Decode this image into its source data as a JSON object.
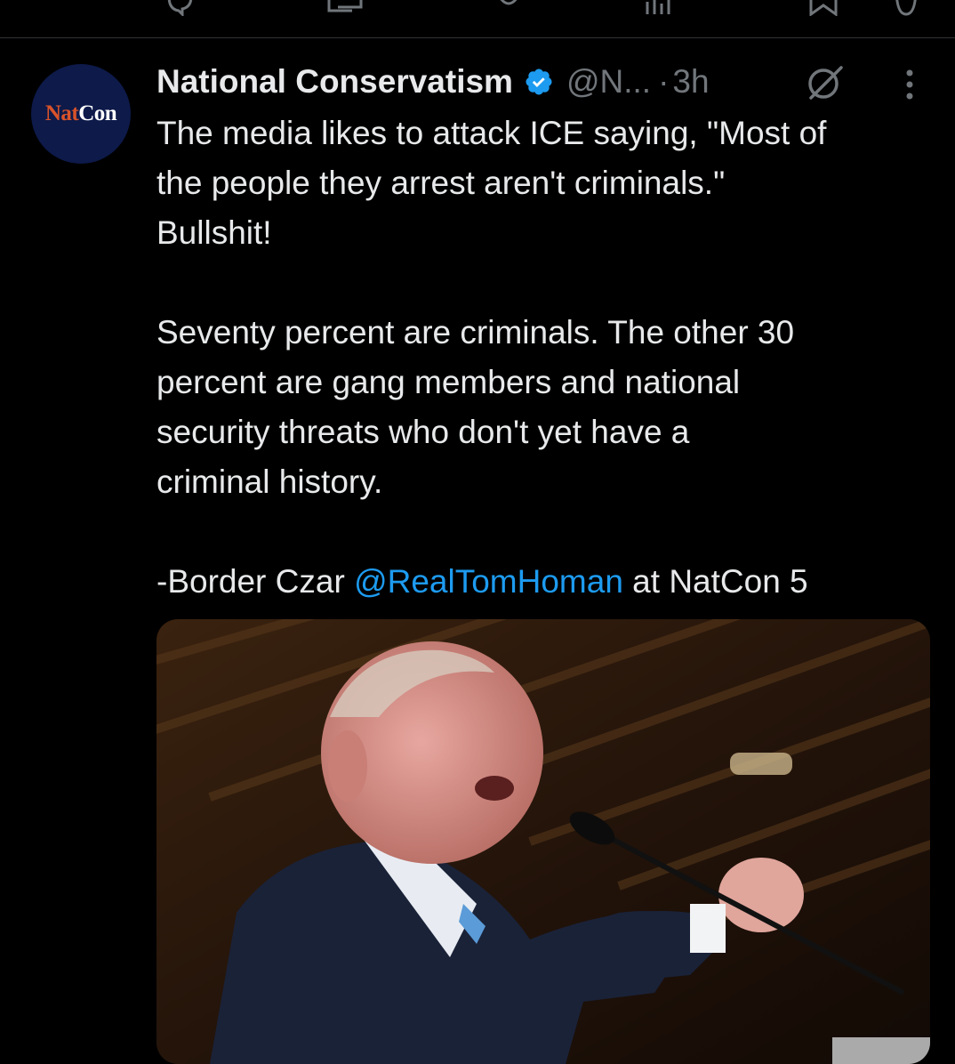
{
  "post": {
    "author_name": "National Conservatism",
    "handle": "@N...",
    "dot": "·",
    "time": "3h",
    "avatar_text_a": "Nat",
    "avatar_text_b": "Con",
    "body": {
      "line1": "The media likes to attack ICE saying, \"Most of",
      "line2": "the people they arrest aren't criminals.\"",
      "line3": "Bullshit!",
      "line4": "Seventy percent are criminals. The other 30",
      "line5": "percent are gang members and national",
      "line6": "security threats who don't  yet have a",
      "line7": "criminal history.",
      "attribution_prefix": "-Border Czar ",
      "mention": "@RealTomHoman",
      "attribution_suffix": " at NatCon 5"
    }
  },
  "icons": {
    "verified": "verified-badge-icon",
    "grok": "grok-icon",
    "more": "more-vertical-icon",
    "top_bar": [
      "reply-icon",
      "retweet-icon",
      "like-icon",
      "views-icon",
      "bookmark-icon",
      "share-icon"
    ]
  },
  "colors": {
    "background": "#000000",
    "text": "#e7e9ea",
    "muted": "#71767b",
    "link": "#1d9bf0",
    "verified": "#1d9bf0",
    "avatar_bg": "#0d1a4a",
    "avatar_accent": "#d9532a"
  }
}
